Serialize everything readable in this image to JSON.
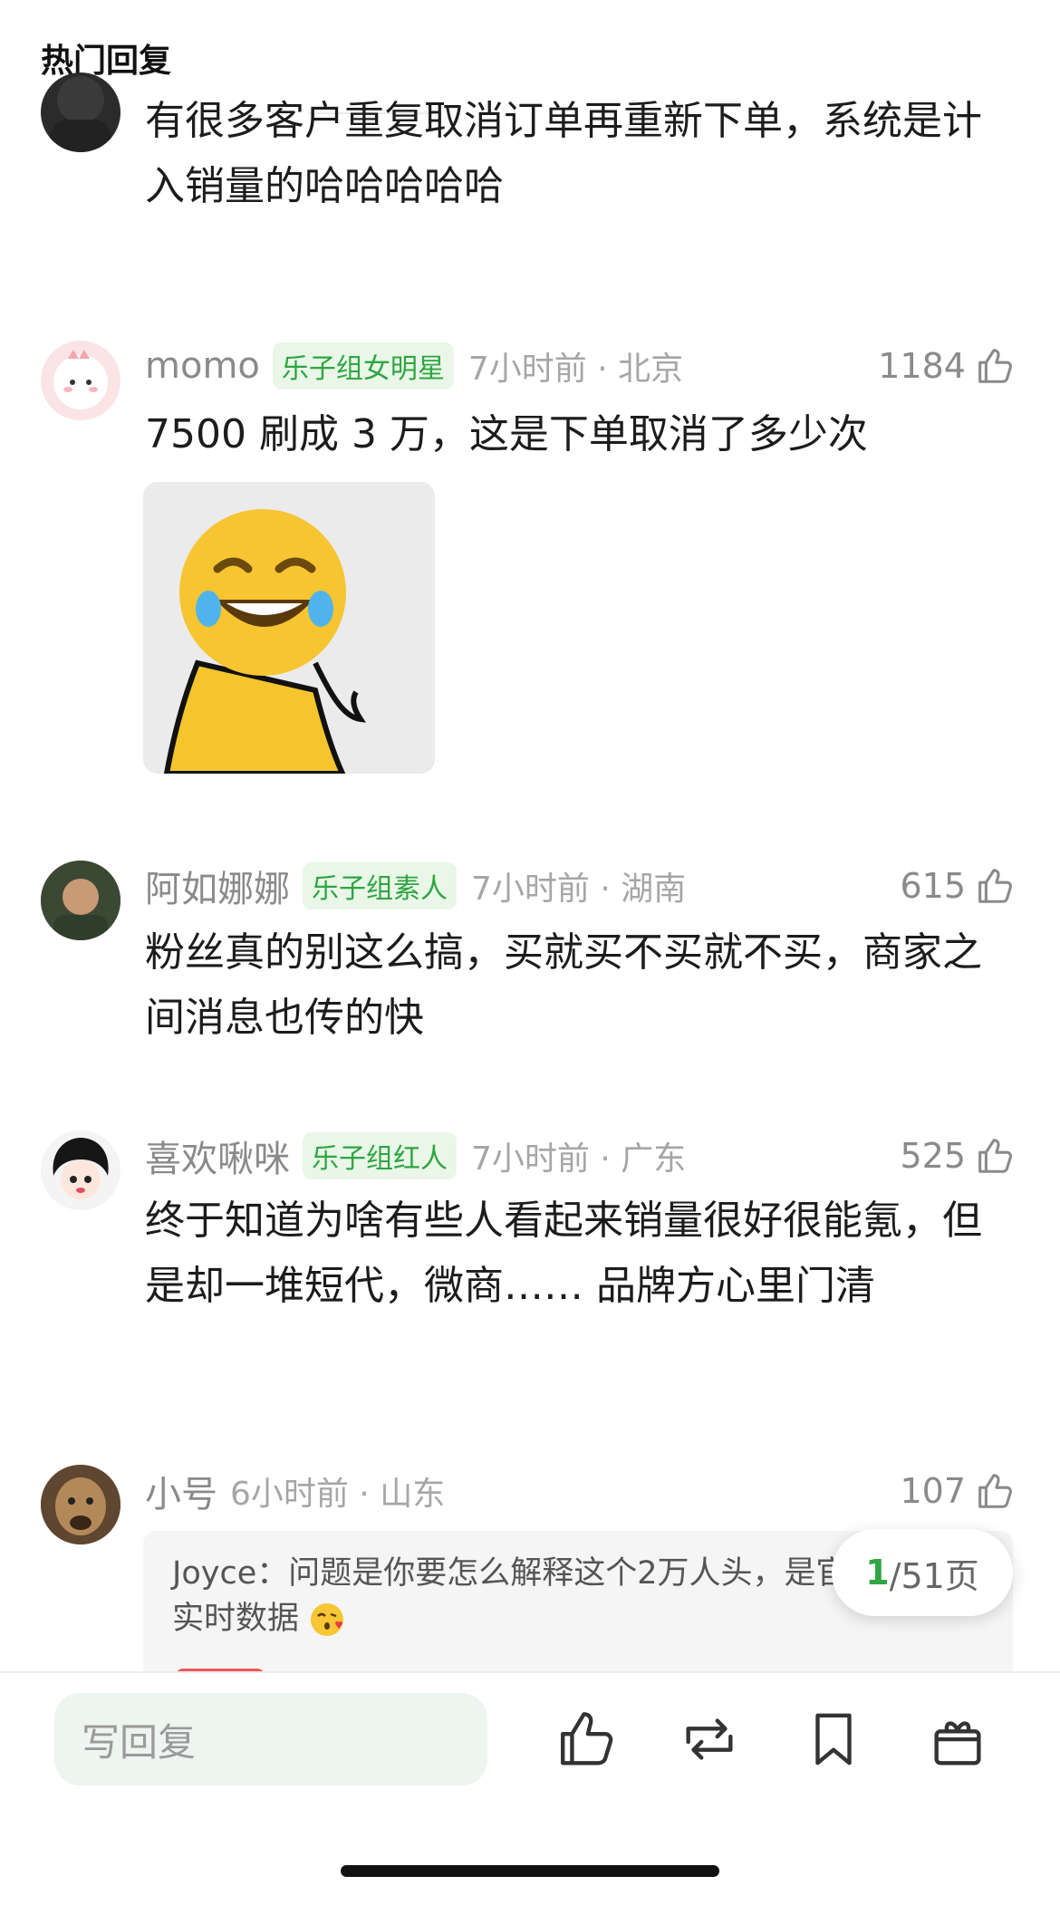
{
  "header": {
    "title": "热门回复"
  },
  "comments": [
    {
      "text": "有很多客户重复取消订单再重新下单，系统是计入销量的哈哈哈哈哈"
    },
    {
      "name": "momo",
      "badge": "乐子组女明星",
      "meta": "7小时前 · 北京",
      "likes": "1184",
      "text": "7500 刷成 3 万，这是下单取消了多少次"
    },
    {
      "name": "阿如娜娜",
      "badge": "乐子组素人",
      "meta": "7小时前 · 湖南",
      "likes": "615",
      "text": "粉丝真的别这么搞，买就买不买就不买，商家之间消息也传的快"
    },
    {
      "name": "喜欢啾咪",
      "badge": "乐子组红人",
      "meta": "7小时前 · 广东",
      "likes": "525",
      "text": "终于知道为啥有些人看起来销量很好很能氪，但是却一堆短代，微商…… 品牌方心里门清"
    },
    {
      "name": "小号",
      "meta": "6小时前 · 山东",
      "likes": "107",
      "reply": {
        "author": "Joyce：",
        "text": "问题是你要怎么解释这个2万人头，是官宣当日的实时数据"
      }
    }
  ],
  "pagination": {
    "current": "1",
    "total": "/51页"
  },
  "bottom_bar": {
    "reply_placeholder": "写回复"
  },
  "colors": {
    "accent": "#2fa543",
    "badge_bg": "#e9f6e8",
    "meta": "#a6a6a6"
  },
  "icons": [
    "like-icon",
    "repost-icon",
    "bookmark-icon",
    "gift-icon"
  ]
}
